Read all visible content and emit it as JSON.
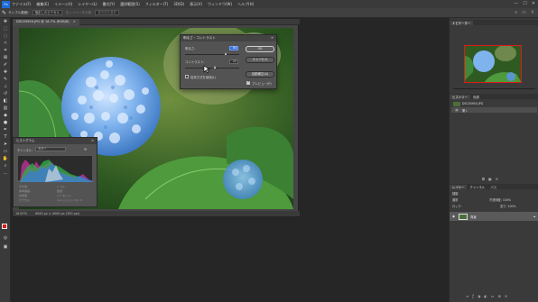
{
  "menubar": {
    "app_icon": "Ps",
    "items": [
      "ファイル(F)",
      "編集(E)",
      "イメージ(I)",
      "レイヤー(L)",
      "書式(Y)",
      "選択範囲(S)",
      "フィルター(T)",
      "3D(D)",
      "表示(V)",
      "ウィンドウ(W)",
      "ヘルプ(H)"
    ],
    "window_buttons": [
      "—",
      "☐",
      "✕"
    ]
  },
  "options_bar": {
    "tool_icon": "brush-icon",
    "sample_label": "サンプル範囲:",
    "sample_value": "指定したピクセル",
    "sample_all_layers": "全レイヤーを対象",
    "select_subject_label": "被写体を選択",
    "right_icons": [
      "search-icon",
      "workspace-icon",
      "share-icon"
    ]
  },
  "document": {
    "tab_title": "DSC05950.JPG @ 16.7% (RGB/8)",
    "close": "✕",
    "status_zoom": "16.67%",
    "status_size": "6000 px × 4000 px (350 ppi)"
  },
  "brightness_dialog": {
    "title": "明るさ・コントラスト",
    "close": "✕",
    "brightness_label": "明るさ:",
    "brightness_value": "84",
    "brightness_level": 0.76,
    "contrast_label": "コントラスト:",
    "contrast_value": "22",
    "contrast_level": 0.56,
    "ok_label": "OK",
    "cancel_label": "キャンセル",
    "auto_label": "自動補正(A)",
    "legacy_label": "従来方式を使用(L)",
    "legacy_checked": false,
    "preview_label": "プレビュー(P)",
    "preview_checked": true
  },
  "histogram_panel": {
    "title": "ヒストグラム",
    "menu": "≡",
    "channel_label": "チャンネル:",
    "channel_value": "カラー",
    "source_label": "ソース:",
    "stats": [
      "平均値:",
      "標準偏差:",
      "中間値:",
      "ピクセル:",
      "レベル:",
      "数量:",
      "パーセント:",
      "キャッシュレベル: 4"
    ]
  },
  "navigator_panel": {
    "tabs": [
      "ナビゲーター"
    ]
  },
  "history_panel": {
    "tabs": [
      "ヒストリー",
      "色調"
    ],
    "items": [
      "DSC05950.JPG",
      "開く"
    ]
  },
  "layers_panel": {
    "tabs": [
      "レイヤー",
      "チャンネル",
      "パス"
    ],
    "kind_label": "種類",
    "blend_mode": "通常",
    "opacity_label": "不透明度: 100%",
    "lock_label": "ロック:",
    "fill_label": "塗り: 100%",
    "layer_name": "背景",
    "bottom_icons": [
      "link-icon",
      "fx-icon",
      "mask-icon",
      "adjust-icon",
      "folder-icon",
      "new-layer-icon",
      "trash-icon"
    ]
  },
  "colors": {
    "foreground": "#e01919",
    "background": "#ffffff",
    "accent": "#3b6fd6"
  }
}
